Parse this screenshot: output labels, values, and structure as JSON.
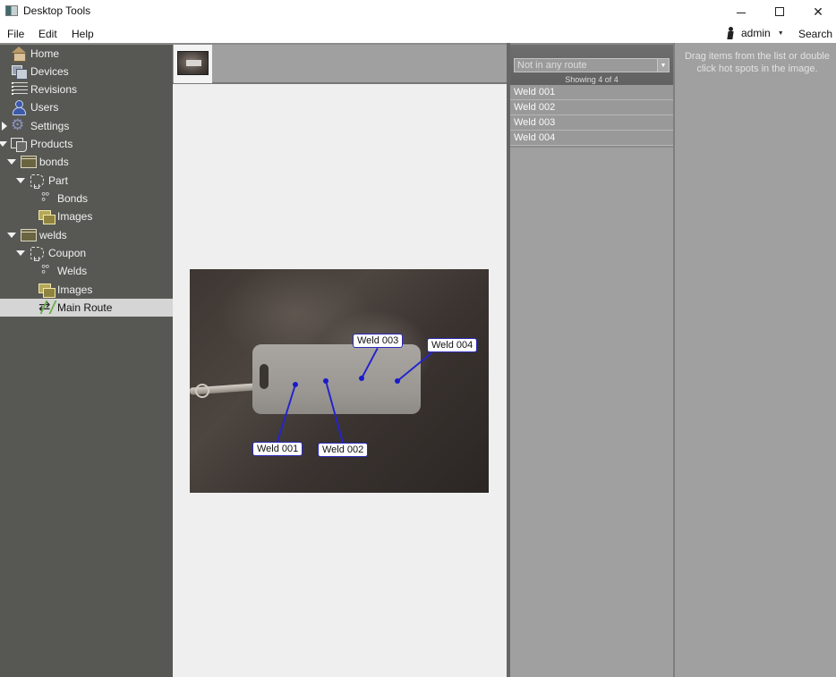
{
  "window": {
    "title": "Desktop Tools",
    "controls": {
      "minimize": "minimize",
      "maximize": "maximize",
      "close": "close"
    }
  },
  "menu": {
    "items": [
      "File",
      "Edit",
      "Help"
    ],
    "user": "admin",
    "search": "Search"
  },
  "sidebar": {
    "items": [
      {
        "label": "Home",
        "icon": "home-icon"
      },
      {
        "label": "Devices",
        "icon": "devices-icon"
      },
      {
        "label": "Revisions",
        "icon": "list-icon"
      },
      {
        "label": "Users",
        "icon": "user-icon"
      },
      {
        "label": "Settings",
        "icon": "gear-icon",
        "expanded": false
      },
      {
        "label": "Products",
        "icon": "products-icon",
        "expanded": true
      },
      {
        "label": "bonds",
        "icon": "folder-icon",
        "expanded": true
      },
      {
        "label": "Part",
        "icon": "part-icon",
        "expanded": true
      },
      {
        "label": "Bonds",
        "icon": "hotspots-icon"
      },
      {
        "label": "Images",
        "icon": "images-icon"
      },
      {
        "label": "welds",
        "icon": "folder-icon",
        "expanded": true
      },
      {
        "label": "Coupon",
        "icon": "part-icon",
        "expanded": true
      },
      {
        "label": "Welds",
        "icon": "hotspots-icon"
      },
      {
        "label": "Images",
        "icon": "images-icon"
      },
      {
        "label": "Main Route",
        "icon": "route-icon",
        "selected": true
      }
    ]
  },
  "viewer": {
    "thumbnails": [
      {
        "name": "coupon photo"
      }
    ],
    "hotspots": [
      {
        "label": "Weld 001"
      },
      {
        "label": "Weld 002"
      },
      {
        "label": "Weld 003"
      },
      {
        "label": "Weld 004"
      }
    ],
    "hotspot_color": "#2424cc"
  },
  "weld_list": {
    "filter_value": "Not in any route",
    "showing": "Showing 4 of 4",
    "items": [
      "Weld 001",
      "Weld 002",
      "Weld 003",
      "Weld 004"
    ]
  },
  "route_panel": {
    "hint": "Drag items from the list or double click hot spots in the image."
  }
}
